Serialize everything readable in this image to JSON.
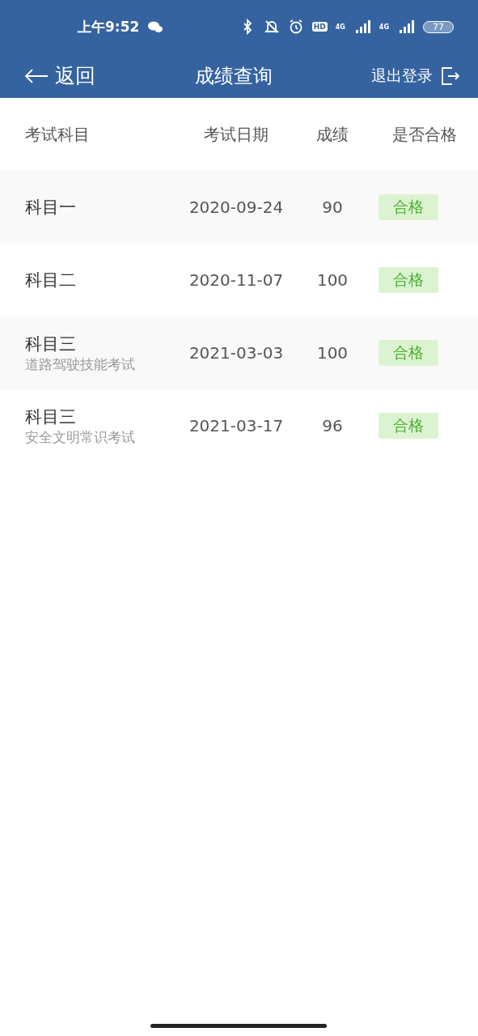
{
  "status_bar": {
    "time": "上午9:52",
    "hd": "HD",
    "network_1": "4G",
    "network_2": "4G",
    "battery": "77"
  },
  "header": {
    "back": "返回",
    "title": "成绩查询",
    "logout": "退出登录"
  },
  "table": {
    "columns": [
      "考试科目",
      "考试日期",
      "成绩",
      "是否合格"
    ],
    "rows": [
      {
        "subject": "科目一",
        "date": "2020-09-24",
        "score": "90",
        "result": {
          "text": "合格",
          "passed": true
        }
      },
      {
        "subject": "科目二",
        "date": "2020-11-07",
        "score": "100",
        "result": {
          "text": "合格",
          "passed": true
        }
      },
      {
        "subject": "科目三",
        "detail": "道路驾驶技能考试",
        "date": "2021-03-03",
        "score": "100",
        "result": {
          "text": "合格",
          "passed": true
        }
      },
      {
        "subject": "科目三",
        "detail": "安全文明常识考试",
        "date": "2021-03-17",
        "score": "96",
        "result": {
          "text": "合格",
          "passed": true
        }
      }
    ]
  }
}
